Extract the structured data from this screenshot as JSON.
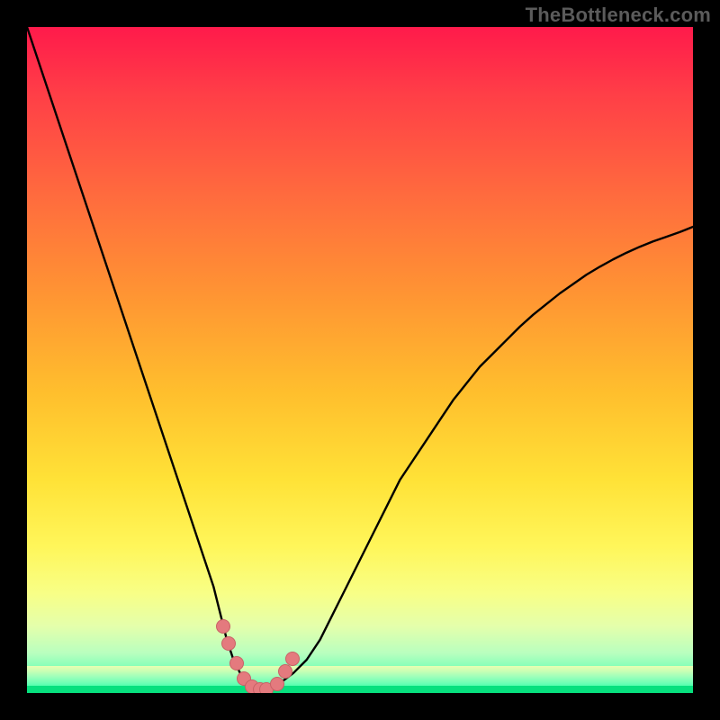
{
  "watermark": "TheBottleneck.com",
  "chart_data": {
    "type": "line",
    "title": "",
    "xlabel": "",
    "ylabel": "",
    "xlim": [
      0,
      100
    ],
    "ylim": [
      0,
      100
    ],
    "grid": false,
    "legend": false,
    "x": [
      0,
      2,
      4,
      6,
      8,
      10,
      12,
      14,
      16,
      18,
      20,
      22,
      24,
      26,
      28,
      29,
      30,
      31,
      32,
      33,
      34,
      35,
      36,
      37,
      38,
      40,
      42,
      44,
      46,
      48,
      50,
      52,
      54,
      56,
      58,
      60,
      62,
      64,
      66,
      68,
      70,
      72,
      74,
      76,
      78,
      80,
      82,
      84,
      86,
      88,
      90,
      92,
      94,
      96,
      98,
      100
    ],
    "values": [
      100,
      94,
      88,
      82,
      76,
      70,
      64,
      58,
      52,
      46,
      40,
      34,
      28,
      22,
      16,
      12,
      8,
      5,
      3,
      1.5,
      0.8,
      0.5,
      0.5,
      0.8,
      1.5,
      3,
      5,
      8,
      12,
      16,
      20,
      24,
      28,
      32,
      35,
      38,
      41,
      44,
      46.5,
      49,
      51,
      53,
      55,
      56.8,
      58.4,
      60,
      61.4,
      62.8,
      64,
      65.1,
      66.1,
      67,
      67.8,
      68.5,
      69.2,
      70
    ],
    "markers_x": [
      29.5,
      30.3,
      31.5,
      32.5,
      33.8,
      35,
      36,
      37.5,
      38.8,
      39.8
    ],
    "markers_y": [
      10,
      7.5,
      4.5,
      2.2,
      1,
      0.5,
      0.6,
      1.3,
      3.2,
      5.2
    ],
    "background": "rainbow_vertical_gradient",
    "annotations": []
  },
  "colors": {
    "curve": "#000000",
    "marker_fill": "#e47a7e",
    "marker_stroke": "#c96166",
    "frame": "#000000"
  }
}
